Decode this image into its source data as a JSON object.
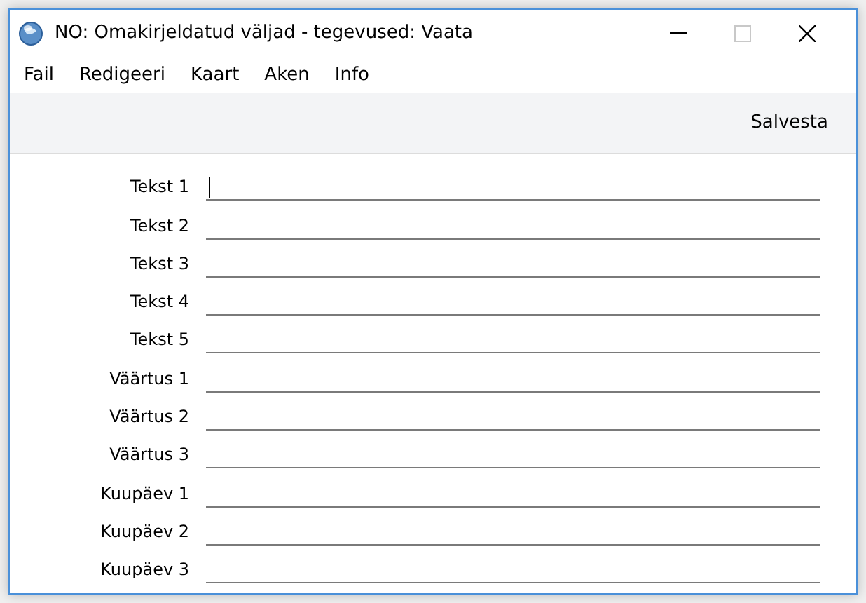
{
  "window": {
    "title": "NO: Omakirjeldatud väljad - tegevused: Vaata"
  },
  "menu": [
    "Fail",
    "Redigeeri",
    "Kaart",
    "Aken",
    "Info"
  ],
  "toolbar": {
    "buttons": [
      "Salvesta"
    ]
  },
  "fields": [
    {
      "label": "Tekst 1",
      "focused": true
    },
    {
      "label": "Tekst 2",
      "focused": false
    },
    {
      "label": "Tekst 3",
      "focused": false
    },
    {
      "label": "Tekst 4",
      "focused": false
    },
    {
      "label": "Tekst 5",
      "focused": false
    },
    {
      "label": "Väärtus 1",
      "focused": false
    },
    {
      "label": "Väärtus 2",
      "focused": false
    },
    {
      "label": "Väärtus 3",
      "focused": false
    },
    {
      "label": "Kuupäev 1",
      "focused": false
    },
    {
      "label": "Kuupäev 2",
      "focused": false
    },
    {
      "label": "Kuupäev 3",
      "focused": false
    }
  ]
}
